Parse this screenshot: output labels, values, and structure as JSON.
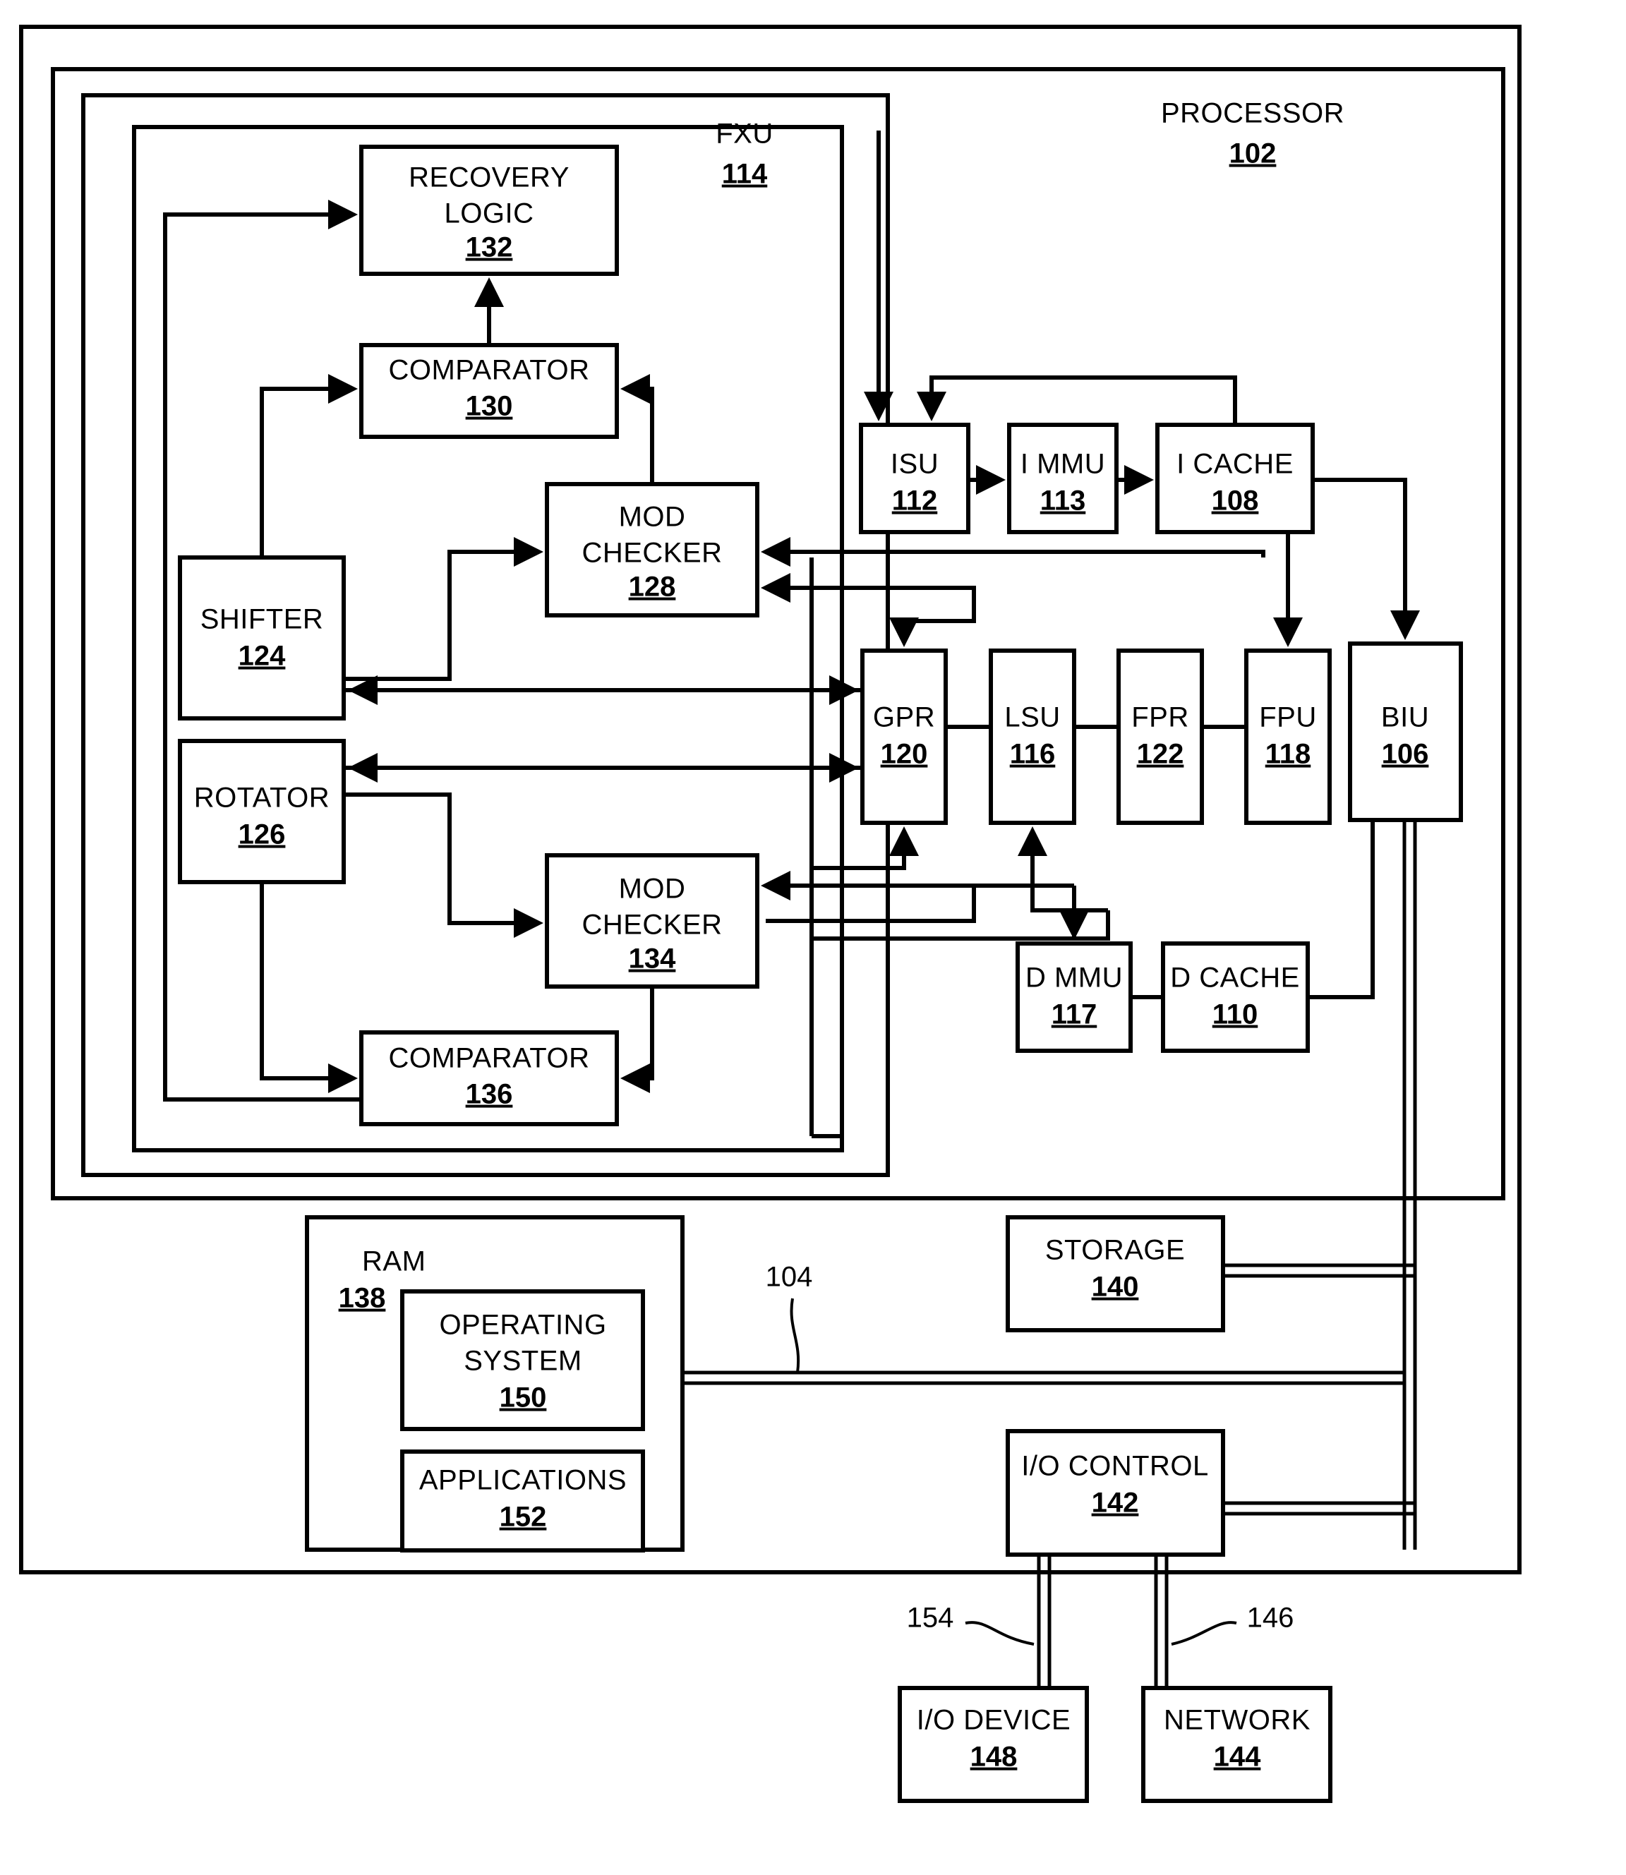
{
  "figure": {
    "type": "patent-block-diagram",
    "title_text": "",
    "outer_label": {
      "name": "PROCESSOR",
      "ref": "102"
    },
    "fxu_label": {
      "name": "FXU",
      "ref": "114"
    },
    "bus_ref": "104",
    "io_device_ref": "154",
    "network_ref": "146"
  },
  "blocks": {
    "recovery_logic": {
      "line1": "RECOVERY",
      "line2": "LOGIC",
      "ref": "132"
    },
    "comparator_130": {
      "line1": "COMPARATOR",
      "ref": "130"
    },
    "mod_checker_128": {
      "line1": "MOD",
      "line2": "CHECKER",
      "ref": "128"
    },
    "shifter": {
      "line1": "SHIFTER",
      "ref": "124"
    },
    "rotator": {
      "line1": "ROTATOR",
      "ref": "126"
    },
    "mod_checker_134": {
      "line1": "MOD",
      "line2": "CHECKER",
      "ref": "134"
    },
    "comparator_136": {
      "line1": "COMPARATOR",
      "ref": "136"
    },
    "isu": {
      "line1": "ISU",
      "ref": "112"
    },
    "immu": {
      "line1": "I MMU",
      "ref": "113"
    },
    "icache": {
      "line1": "I CACHE",
      "ref": "108"
    },
    "gpr": {
      "line1": "GPR",
      "ref": "120"
    },
    "lsu": {
      "line1": "LSU",
      "ref": "116"
    },
    "fpr": {
      "line1": "FPR",
      "ref": "122"
    },
    "fpu": {
      "line1": "FPU",
      "ref": "118"
    },
    "biu": {
      "line1": "BIU",
      "ref": "106"
    },
    "dmmu": {
      "line1": "D MMU",
      "ref": "117"
    },
    "dcache": {
      "line1": "D CACHE",
      "ref": "110"
    },
    "ram": {
      "line1": "RAM",
      "ref": "138"
    },
    "operating_system": {
      "line1": "OPERATING",
      "line2": "SYSTEM",
      "ref": "150"
    },
    "applications": {
      "line1": "APPLICATIONS",
      "ref": "152"
    },
    "storage": {
      "line1": "STORAGE",
      "ref": "140"
    },
    "io_control": {
      "line1": "I/O CONTROL",
      "ref": "142"
    },
    "io_device": {
      "line1": "I/O DEVICE",
      "ref": "148"
    },
    "network": {
      "line1": "NETWORK",
      "ref": "144"
    }
  },
  "colors": {
    "stroke": "#000000",
    "fill": "#ffffff"
  }
}
